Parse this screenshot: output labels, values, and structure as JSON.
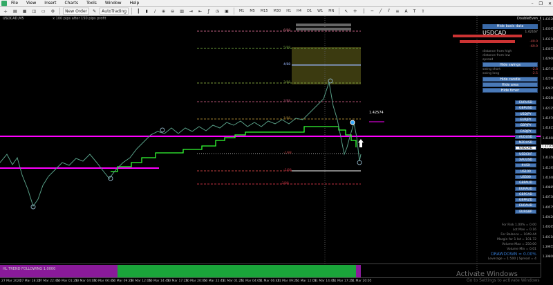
{
  "menubar": {
    "items": [
      "File",
      "View",
      "Insert",
      "Charts",
      "Tools",
      "Window",
      "Help"
    ]
  },
  "toolbar": {
    "new_order": "New Order",
    "auto_trading": "AutoTrading",
    "timeframes": [
      "M1",
      "M5",
      "M15",
      "M30",
      "H1",
      "H4",
      "D1",
      "W1",
      "MN"
    ]
  },
  "chart": {
    "symbol": "USDCAD,M5",
    "subtitle": "x 100 pips after 150 pips profit",
    "tag_price": "1.42574",
    "right_title": "DoubleEven_mx"
  },
  "fibo_levels": [
    {
      "label": "6/88"
    },
    {
      "label": "5/88"
    },
    {
      "label": "4/88"
    },
    {
      "label": "3/88"
    },
    {
      "label": "2/88"
    },
    {
      "label": "1/88"
    },
    {
      "label": "-1/88"
    },
    {
      "label": "-2/88"
    },
    {
      "label": "-3/88"
    }
  ],
  "panel": {
    "title": "Hide basic data",
    "pair": "USDCAD",
    "rows": [
      {
        "k": "",
        "v": "1.42167"
      },
      {
        "k": "",
        "v": "-40.0"
      },
      {
        "k": "",
        "v": "-69.9"
      },
      {
        "k": "distance from high",
        "v": ""
      },
      {
        "k": "distance from low",
        "v": ""
      },
      {
        "k": "spread",
        "v": ""
      }
    ],
    "hide_swings": "Hide swings",
    "swing_rows": [
      {
        "k": "swing short",
        "v": "-2.8"
      },
      {
        "k": "swing long",
        "v": "-2.5"
      }
    ],
    "hide_candle": "Hide candle",
    "hide_area": "Hide area",
    "hide_timer": "Hide timer"
  },
  "symbols": [
    "EURUSD",
    "GBPUSD",
    "USDJPY",
    "EURJPY",
    "GBPJPY",
    "CADJPY",
    "AUDUSD",
    "NZDUSD",
    "USDCAD",
    "USDCHF",
    "XAUUSD",
    "#ASX",
    "US100",
    "US500",
    "GBPAUD",
    "EURAUD",
    "GBPCAD",
    "GBPNZD",
    "EURAUD",
    "EURGBP"
  ],
  "selected_symbol": "USDCAD",
  "stats": [
    "For Risk 1.00% = 0.00",
    "Lot Max = 0.16",
    "For Balance = 1049.44",
    "Margin for 1 lot = 101.72",
    "Volume Max = 250.00",
    "Volume Min = 0.01"
  ],
  "drawdown": "DRAWDOWN = 0.00%",
  "leverage": "Leverage = 1:500 | Spread = 4",
  "indicator": {
    "label": "HL TREND FOLLOWING 1.0000"
  },
  "price_scale": [
    "1.43520",
    "1.43365",
    "1.43210",
    "1.43055",
    "1.42900",
    "1.42745",
    "1.42590",
    "1.42435",
    "1.42280",
    "1.42125",
    "1.41970",
    "1.41815",
    "1.41660",
    "1.41505",
    "1.41350",
    "1.41195",
    "1.41040",
    "1.40885",
    "1.40730",
    "1.40575",
    "1.40420",
    "1.40265",
    "1.40110",
    "1.39955",
    "1.39800"
  ],
  "current_price": "1.42167",
  "time_axis": [
    "27 Mar 2020",
    "27 Mar 18:20",
    "27 Mar 22:45",
    "30 Mar 01:25",
    "30 Mar 04:05",
    "30 Mar 06:45",
    "30 Mar 09:25",
    "30 Mar 12:05",
    "30 Mar 14:45",
    "30 Mar 17:25",
    "30 Mar 20:05",
    "30 Mar 22:45",
    "31 Mar 01:25",
    "31 Mar 04:05",
    "31 Mar 06:45",
    "31 Mar 09:25",
    "31 Mar 12:05",
    "31 Mar 14:45",
    "31 Mar 17:25",
    "31 Mar 20:05"
  ],
  "watermark": {
    "title": "Activate Windows",
    "sub": "Go to Settings to activate Windows"
  },
  "colors": {
    "magenta": "#ff00ff",
    "green_line": "#33ff33",
    "accent_blue": "#4a7ab8"
  }
}
